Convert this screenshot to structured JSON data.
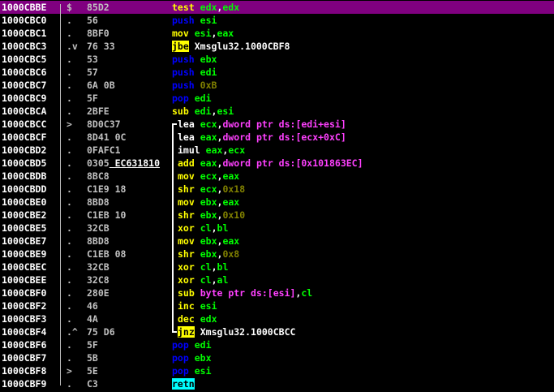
{
  "colors": {
    "background": "#000000",
    "selected_row": "#800080",
    "address": "#ffffff",
    "hex": "#c0c0c0",
    "mnemonic_default": "#ffff00",
    "stack_ops": "#0000ff",
    "jump_highlight": "#ffff00",
    "ret_highlight": "#00ffff",
    "memory_operand": "#ff40ff",
    "immediate": "#808000",
    "register": "#ffff00"
  },
  "rows": [
    {
      "addr": "1000CBBE",
      "mark": "$",
      "hex": "85D2",
      "mnem": "test",
      "ops": "edx,edx",
      "cls": "op-test",
      "sel": true
    },
    {
      "addr": "1000CBC0",
      "mark": ".",
      "hex": "56",
      "mnem": "push",
      "ops": "esi",
      "cls": "op-stack"
    },
    {
      "addr": "1000CBC1",
      "mark": ".",
      "hex": "8BF0",
      "mnem": "mov",
      "ops": "esi,eax",
      "cls": "op-mov"
    },
    {
      "addr": "1000CBC3",
      "mark": ".v",
      "hex": "76 33",
      "mnem": "jbe",
      "ops": "Xmsglu32.1000CBF8",
      "cls": "op-jbe"
    },
    {
      "addr": "1000CBC5",
      "mark": ".",
      "hex": "53",
      "mnem": "push",
      "ops": "ebx",
      "cls": "op-stack"
    },
    {
      "addr": "1000CBC6",
      "mark": ".",
      "hex": "57",
      "mnem": "push",
      "ops": "edi",
      "cls": "op-stack"
    },
    {
      "addr": "1000CBC7",
      "mark": ".",
      "hex": "6A 0B",
      "mnem": "push",
      "ops": "0xB",
      "cls": "op-stack"
    },
    {
      "addr": "1000CBC9",
      "mark": ".",
      "hex": "5F",
      "mnem": "pop",
      "ops": "edi",
      "cls": "op-stack"
    },
    {
      "addr": "1000CBCA",
      "mark": ".",
      "hex": "2BFE",
      "mnem": "sub",
      "ops": "edi,esi",
      "cls": "op-mov"
    },
    {
      "addr": "1000CBCC",
      "mark": ">",
      "hex": "8D0C37",
      "mnem": "lea",
      "ops": "ecx,dword ptr ds:[edi+esi]",
      "cls": "op-lea"
    },
    {
      "addr": "1000CBCF",
      "mark": ".",
      "hex": "8D41 0C",
      "mnem": "lea",
      "ops": "eax,dword ptr ds:[ecx+0xC]",
      "cls": "op-lea"
    },
    {
      "addr": "1000CBD2",
      "mark": ".",
      "hex": "0FAFC1",
      "mnem": "imul",
      "ops": "eax,ecx",
      "cls": "op-lea"
    },
    {
      "addr": "1000CBD5",
      "mark": ".",
      "hex": "0305",
      "hex2": "EC631810",
      "mnem": "add",
      "ops": "eax,dword ptr ds:[0x101863EC]",
      "cls": "op-mov"
    },
    {
      "addr": "1000CBDB",
      "mark": ".",
      "hex": "8BC8",
      "mnem": "mov",
      "ops": "ecx,eax",
      "cls": "op-mov"
    },
    {
      "addr": "1000CBDD",
      "mark": ".",
      "hex": "C1E9 18",
      "mnem": "shr",
      "ops": "ecx,0x18",
      "cls": "op-mov"
    },
    {
      "addr": "1000CBE0",
      "mark": ".",
      "hex": "8BD8",
      "mnem": "mov",
      "ops": "ebx,eax",
      "cls": "op-mov"
    },
    {
      "addr": "1000CBE2",
      "mark": ".",
      "hex": "C1EB 10",
      "mnem": "shr",
      "ops": "ebx,0x10",
      "cls": "op-mov"
    },
    {
      "addr": "1000CBE5",
      "mark": ".",
      "hex": "32CB",
      "mnem": "xor",
      "ops": "cl,bl",
      "cls": "op-mov"
    },
    {
      "addr": "1000CBE7",
      "mark": ".",
      "hex": "8BD8",
      "mnem": "mov",
      "ops": "ebx,eax",
      "cls": "op-mov"
    },
    {
      "addr": "1000CBE9",
      "mark": ".",
      "hex": "C1EB 08",
      "mnem": "shr",
      "ops": "ebx,0x8",
      "cls": "op-mov"
    },
    {
      "addr": "1000CBEC",
      "mark": ".",
      "hex": "32CB",
      "mnem": "xor",
      "ops": "cl,bl",
      "cls": "op-mov"
    },
    {
      "addr": "1000CBEE",
      "mark": ".",
      "hex": "32C8",
      "mnem": "xor",
      "ops": "cl,al",
      "cls": "op-mov"
    },
    {
      "addr": "1000CBF0",
      "mark": ".",
      "hex": "280E",
      "mnem": "sub",
      "ops": "byte ptr ds:[esi],cl",
      "cls": "op-mov"
    },
    {
      "addr": "1000CBF2",
      "mark": ".",
      "hex": "46",
      "mnem": "inc",
      "ops": "esi",
      "cls": "op-mov"
    },
    {
      "addr": "1000CBF3",
      "mark": ".",
      "hex": "4A",
      "mnem": "dec",
      "ops": "edx",
      "cls": "op-mov"
    },
    {
      "addr": "1000CBF4",
      "mark": ".^",
      "hex": "75 D6",
      "mnem": "jnz",
      "ops": "Xmsglu32.1000CBCC",
      "cls": "op-jbe"
    },
    {
      "addr": "1000CBF6",
      "mark": ".",
      "hex": "5F",
      "mnem": "pop",
      "ops": "edi",
      "cls": "op-stack"
    },
    {
      "addr": "1000CBF7",
      "mark": ".",
      "hex": "5B",
      "mnem": "pop",
      "ops": "ebx",
      "cls": "op-stack"
    },
    {
      "addr": "1000CBF8",
      "mark": ">",
      "hex": "5E",
      "mnem": "pop",
      "ops": "esi",
      "cls": "op-stack"
    },
    {
      "addr": "1000CBF9",
      "mark": ".",
      "hex": "C3",
      "mnem": "retn",
      "ops": "",
      "cls": "op-ret"
    }
  ]
}
